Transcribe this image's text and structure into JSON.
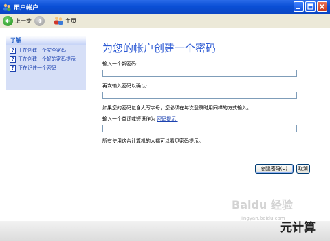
{
  "window": {
    "title": "用户帐户",
    "controls": [
      "minimize-icon",
      "maximize-icon",
      "close-icon"
    ]
  },
  "toolbar": {
    "back_label": "上一步",
    "home_label": "主页"
  },
  "sidebar": {
    "header": "了解",
    "items": [
      {
        "label": "正在创建一个安全密码",
        "icon": "help-icon"
      },
      {
        "label": "正在创建一个好的密码提示",
        "icon": "help-icon"
      },
      {
        "label": "正在记住一个密码",
        "icon": "help-icon"
      }
    ]
  },
  "main": {
    "title": "为您的帐户创建一个密码",
    "new_password_label": "输入一个新密码:",
    "new_password_value": "",
    "confirm_label": "再次输入密码以确认:",
    "confirm_value": "",
    "case_note": "如果您的密码包含大写字母，您必须在每次登录时用同样的方式输入。",
    "hint_prefix": "输入一个单词或短语作为",
    "hint_link": "密码提示:",
    "hint_value": "",
    "visibility_note": "所有使用这台计算机的人都可以看见密码提示。"
  },
  "buttons": {
    "create": "创建密码(C)",
    "cancel": "取消"
  },
  "watermark": {
    "main": "Baidu 经验",
    "sub": "jingyan.baidu.com",
    "corner": "元计算"
  }
}
